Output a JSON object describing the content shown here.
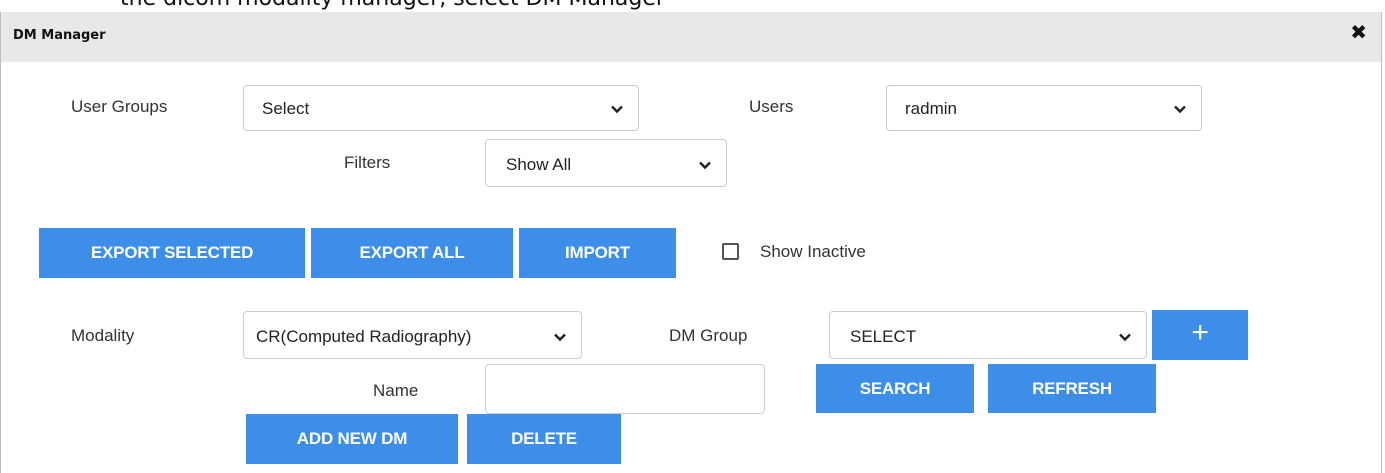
{
  "background_caption": "the dicom modality manager, select DM Manager",
  "dialog": {
    "title": "DM Manager",
    "close_symbol": "✖"
  },
  "user_groups": {
    "label": "User Groups",
    "selected": "Select"
  },
  "users": {
    "label": "Users",
    "selected": "radmin"
  },
  "filters": {
    "label": "Filters",
    "selected": "Show All"
  },
  "actions": {
    "export_selected": "EXPORT SELECTED",
    "export_all": "EXPORT ALL",
    "import": "IMPORT",
    "show_inactive": "Show Inactive",
    "show_inactive_checked": false
  },
  "modality": {
    "label": "Modality",
    "selected": "CR(Computed Radiography)"
  },
  "dm_group": {
    "label": "DM Group",
    "selected": "SELECT",
    "add_symbol": "+"
  },
  "name_field": {
    "label": "Name",
    "value": ""
  },
  "buttons": {
    "search": "SEARCH",
    "refresh": "REFRESH",
    "add_new_dm": "ADD NEW DM",
    "delete": "DELETE"
  },
  "colors": {
    "accent": "#3d8ee8",
    "titlebar": "#e8e8e8"
  }
}
